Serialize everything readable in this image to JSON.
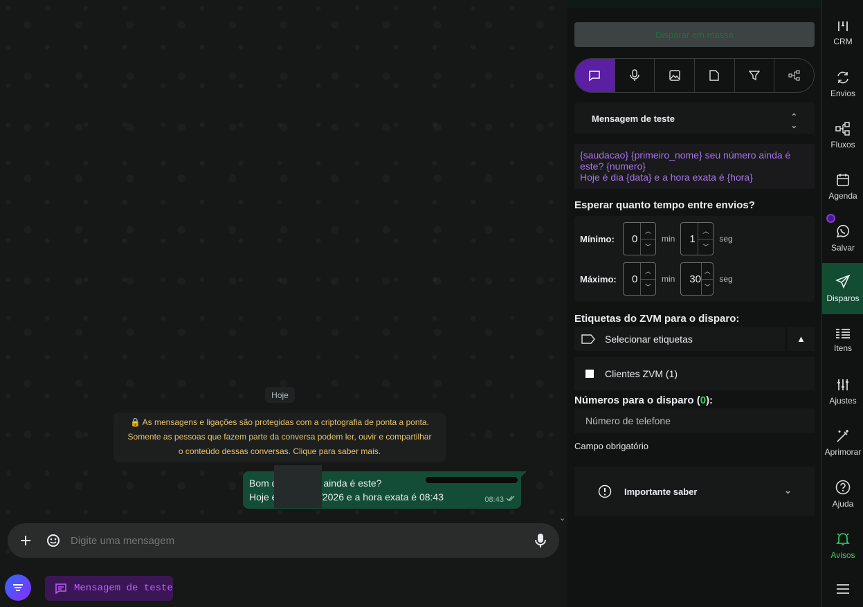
{
  "chat": {
    "day": "Hoje",
    "encryption": [
      "As mensagens e ligações são protegidas com a criptografia de ponta a ponta.",
      "Somente as pessoas que fazem parte da conversa podem ler, ouvir e compartilhar",
      "o conteúdo dessas conversas. Clique para saber mais."
    ],
    "message": {
      "line1": "Bom d           u número ainda é este?",
      "line2": "Hoje é dia 04/06/2026 e a hora exata é 08:43",
      "time": "08:43",
      "status_icon": "double-check-icon"
    },
    "composer": {
      "placeholder": "Digite uma mensagem"
    }
  },
  "bottom": {
    "chip_label": "Mensagem de teste"
  },
  "panel": {
    "mass_button": "Disparar em massa",
    "tabs": [
      "chat-icon",
      "mic-icon",
      "image-icon",
      "file-icon",
      "filter-icon",
      "flow-icon"
    ],
    "template_select": "Mensagem de teste",
    "message_text": "{saudacao} {primeiro_nome} seu número ainda é este? {numero}\nHoje é dia {data} e a hora exata é {hora}",
    "wait_title": "Esperar quanto tempo entre envios?",
    "min": {
      "label": "Mínimo:",
      "minutes": "0",
      "seconds": "1"
    },
    "max": {
      "label": "Máximo:",
      "minutes": "0",
      "seconds": "30"
    },
    "unit_min": "min",
    "unit_sec": "seg",
    "tags_title": "Etiquetas do ZVM para o disparo:",
    "tags_select": "Selecionar etiquetas",
    "tag_option": "Clientes ZVM (1)",
    "numbers_title_pre": "Números para o disparo (",
    "numbers_count": "0",
    "numbers_title_post": "):",
    "phone_placeholder": "Número de telefone",
    "required": "Campo obrigatório",
    "important": "Importante saber"
  },
  "nav": [
    {
      "label": "CRM",
      "icon": "crm-icon"
    },
    {
      "label": "Envios",
      "icon": "refresh-icon"
    },
    {
      "label": "Fluxos",
      "icon": "flow-icon"
    },
    {
      "label": "Agenda",
      "icon": "calendar-icon"
    },
    {
      "label": "Salvar",
      "icon": "whatsapp-icon"
    },
    {
      "label": "Disparos",
      "icon": "send-icon"
    },
    {
      "label": "Itens",
      "icon": "list-icon"
    },
    {
      "label": "Ajustes",
      "icon": "sliders-icon"
    },
    {
      "label": "Aprimorar",
      "icon": "magic-wand-icon"
    },
    {
      "label": "Ajuda",
      "icon": "help-icon"
    },
    {
      "label": "Avisos",
      "icon": "bell-icon"
    }
  ],
  "colors": {
    "accent_purple": "#5b1fa3",
    "active_green": "#114c33",
    "bubble": "#144d37"
  }
}
